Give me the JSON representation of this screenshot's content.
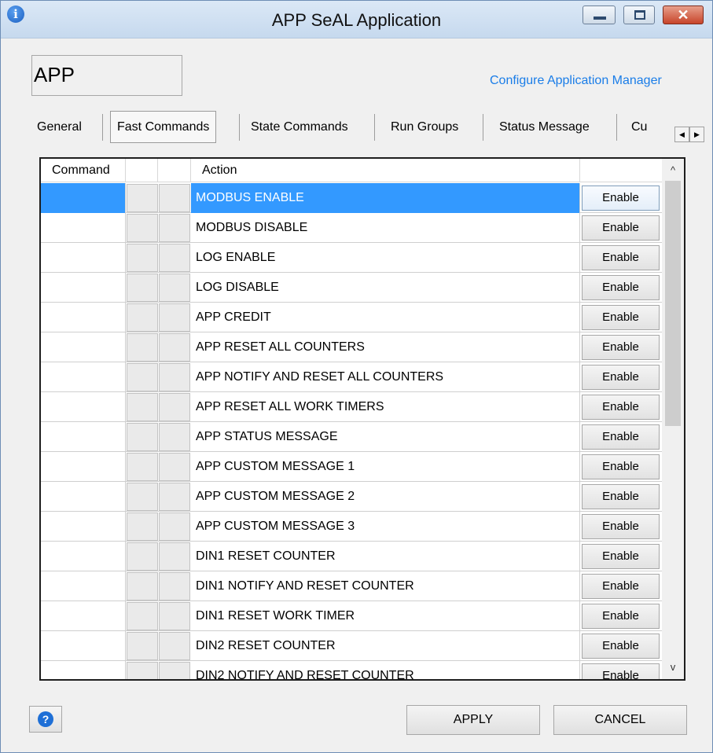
{
  "window": {
    "title": "APP SeAL Application",
    "info_icon": "i",
    "close_glyph": "✕"
  },
  "header": {
    "app_name": "APP",
    "configure_link": "Configure Application Manager"
  },
  "tabs": [
    {
      "label": "General",
      "active": false
    },
    {
      "label": "Fast Commands",
      "active": true
    },
    {
      "label": "State Commands",
      "active": false
    },
    {
      "label": "Run Groups",
      "active": false
    },
    {
      "label": "Status Message",
      "active": false
    },
    {
      "label": "Cu",
      "active": false
    }
  ],
  "tab_scroll": {
    "left": "◀",
    "right": "▶"
  },
  "grid": {
    "headers": {
      "command": "Command",
      "action": "Action"
    },
    "rows": [
      {
        "action": "MODBUS ENABLE",
        "button": "Enable",
        "selected": true
      },
      {
        "action": "MODBUS DISABLE",
        "button": "Enable"
      },
      {
        "action": "LOG ENABLE",
        "button": "Enable"
      },
      {
        "action": "LOG DISABLE",
        "button": "Enable"
      },
      {
        "action": "APP CREDIT",
        "button": "Enable"
      },
      {
        "action": "APP RESET ALL COUNTERS",
        "button": "Enable"
      },
      {
        "action": "APP NOTIFY AND RESET ALL COUNTERS",
        "button": "Enable"
      },
      {
        "action": "APP RESET ALL WORK TIMERS",
        "button": "Enable"
      },
      {
        "action": "APP STATUS MESSAGE",
        "button": "Enable"
      },
      {
        "action": "APP CUSTOM MESSAGE 1",
        "button": "Enable"
      },
      {
        "action": "APP CUSTOM MESSAGE 2",
        "button": "Enable"
      },
      {
        "action": "APP CUSTOM MESSAGE 3",
        "button": "Enable"
      },
      {
        "action": "DIN1 RESET COUNTER",
        "button": "Enable"
      },
      {
        "action": "DIN1 NOTIFY AND RESET COUNTER",
        "button": "Enable"
      },
      {
        "action": "DIN1 RESET WORK TIMER",
        "button": "Enable"
      },
      {
        "action": "DIN2 RESET COUNTER",
        "button": "Enable"
      },
      {
        "action": "DIN2 NOTIFY AND RESET COUNTER",
        "button": "Enable"
      }
    ],
    "scroll_up": "^",
    "scroll_down": "v"
  },
  "footer": {
    "help_glyph": "?",
    "apply_label": "APPLY",
    "cancel_label": "CANCEL"
  },
  "colors": {
    "selection": "#3399ff",
    "link": "#1a7de8"
  }
}
